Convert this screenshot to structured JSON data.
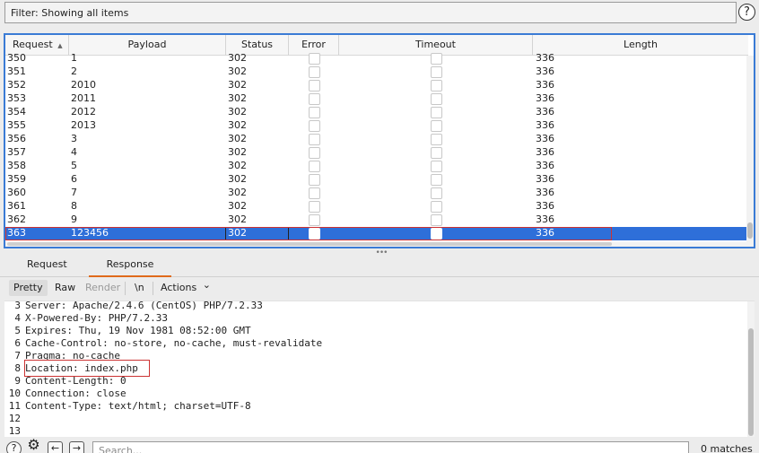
{
  "filter": {
    "text": "Filter: Showing all items"
  },
  "help_icon": "?",
  "table": {
    "columns": [
      "Request",
      "Payload",
      "Status",
      "Error",
      "Timeout",
      "Length"
    ],
    "sort_indicator": "▲",
    "rows": [
      {
        "request": "350",
        "payload": "1",
        "status": "302",
        "length": "336"
      },
      {
        "request": "351",
        "payload": "2",
        "status": "302",
        "length": "336"
      },
      {
        "request": "352",
        "payload": "2010",
        "status": "302",
        "length": "336"
      },
      {
        "request": "353",
        "payload": "2011",
        "status": "302",
        "length": "336"
      },
      {
        "request": "354",
        "payload": "2012",
        "status": "302",
        "length": "336"
      },
      {
        "request": "355",
        "payload": "2013",
        "status": "302",
        "length": "336"
      },
      {
        "request": "356",
        "payload": "3",
        "status": "302",
        "length": "336"
      },
      {
        "request": "357",
        "payload": "4",
        "status": "302",
        "length": "336"
      },
      {
        "request": "358",
        "payload": "5",
        "status": "302",
        "length": "336"
      },
      {
        "request": "359",
        "payload": "6",
        "status": "302",
        "length": "336"
      },
      {
        "request": "360",
        "payload": "7",
        "status": "302",
        "length": "336"
      },
      {
        "request": "361",
        "payload": "8",
        "status": "302",
        "length": "336"
      },
      {
        "request": "362",
        "payload": "9",
        "status": "302",
        "length": "336"
      },
      {
        "request": "363",
        "payload": "123456",
        "status": "302",
        "length": "336",
        "selected": true
      }
    ]
  },
  "tabs": [
    "Request",
    "Response"
  ],
  "active_tab": "Response",
  "toolbar": {
    "pretty": "Pretty",
    "raw": "Raw",
    "render": "Render",
    "newline": "\\n",
    "actions": "Actions",
    "actions_chevron": "⌄"
  },
  "editor": {
    "lines": [
      {
        "n": "3",
        "t": "Server: Apache/2.4.6 (CentOS) PHP/7.2.33"
      },
      {
        "n": "4",
        "t": "X-Powered-By: PHP/7.2.33"
      },
      {
        "n": "5",
        "t": "Expires: Thu, 19 Nov 1981 08:52:00 GMT"
      },
      {
        "n": "6",
        "t": "Cache-Control: no-store, no-cache, must-revalidate"
      },
      {
        "n": "7",
        "t": "Pragma: no-cache"
      },
      {
        "n": "8",
        "t": "Location: index.php"
      },
      {
        "n": "9",
        "t": "Content-Length: 0"
      },
      {
        "n": "10",
        "t": "Connection: close"
      },
      {
        "n": "11",
        "t": "Content-Type: text/html; charset=UTF-8"
      },
      {
        "n": "12",
        "t": ""
      },
      {
        "n": "13",
        "t": ""
      }
    ]
  },
  "bottom": {
    "help": "?",
    "gear": "⚙",
    "back": "←",
    "forward": "→",
    "search_placeholder": "Search...",
    "matches": "0 matches"
  },
  "colors": {
    "selection": "#2e6fd9",
    "highlight_border": "#cc3333",
    "tab_accent": "#e06a1b"
  }
}
